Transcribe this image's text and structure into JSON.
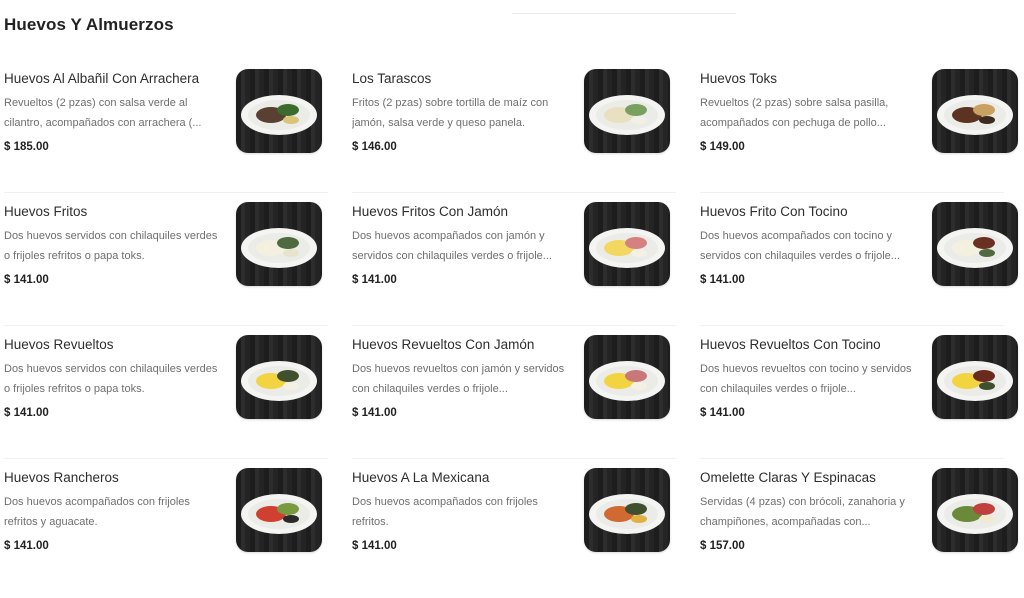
{
  "section": {
    "title": "Huevos Y Almuerzos"
  },
  "items": [
    {
      "name": "Huevos Al Albañil Con Arrachera",
      "desc": "Revueltos (2 pzas) con salsa verde al cilantro, acompañados con arrachera (...",
      "price": "$ 185.00",
      "dish": "eggs-steak-plate-icon"
    },
    {
      "name": "Los Tarascos",
      "desc": "Fritos (2 pzas) sobre tortilla de maíz con jamón, salsa verde y queso panela.",
      "price": "$ 146.00",
      "dish": "tarascos-bowl-icon"
    },
    {
      "name": "Huevos Toks",
      "desc": "Revueltos (2 pzas) sobre salsa pasilla, acompañados con pechuga de pollo...",
      "price": "$ 149.00",
      "dish": "eggs-chicken-plate-icon"
    },
    {
      "name": "Huevos Fritos",
      "desc": "Dos huevos servidos con chilaquiles verdes o frijoles refritos o papa toks.",
      "price": "$ 141.00",
      "dish": "fried-eggs-plate-icon"
    },
    {
      "name": "Huevos Fritos Con Jamón",
      "desc": "Dos huevos acompañados con jamón y servidos con chilaquiles verdes o frijole...",
      "price": "$ 141.00",
      "dish": "fried-eggs-ham-plate-icon"
    },
    {
      "name": "Huevos Frito Con Tocino",
      "desc": "Dos huevos acompañados con tocino y servidos con chilaquiles verdes o frijole...",
      "price": "$ 141.00",
      "dish": "fried-eggs-bacon-plate-icon"
    },
    {
      "name": "Huevos Revueltos",
      "desc": "Dos huevos servidos con chilaquiles verdes o frijoles refritos o papa toks.",
      "price": "$ 141.00",
      "dish": "scrambled-eggs-plate-icon"
    },
    {
      "name": "Huevos Revueltos Con Jamón",
      "desc": "Dos huevos revueltos con jamón y servidos con chilaquiles verdes o frijole...",
      "price": "$ 141.00",
      "dish": "scrambled-eggs-ham-plate-icon"
    },
    {
      "name": "Huevos Revueltos Con Tocino",
      "desc": "Dos huevos revueltos con tocino y servidos con chilaquiles verdes o frijole...",
      "price": "$ 141.00",
      "dish": "scrambled-eggs-bacon-plate-icon"
    },
    {
      "name": "Huevos Rancheros",
      "desc": "Dos huevos acompañados con frijoles refritos y aguacate.",
      "price": "$ 141.00",
      "dish": "rancheros-plate-icon"
    },
    {
      "name": "Huevos A La Mexicana",
      "desc": "Dos huevos acompañados con frijoles refritos.",
      "price": "$ 141.00",
      "dish": "mexicana-eggs-plate-icon"
    },
    {
      "name": "Omelette Claras Y Espinacas",
      "desc": "Servidas (4 pzas) con brócoli, zanahoria y champiñones, acompañadas con...",
      "price": "$ 157.00",
      "dish": "omelette-plate-icon"
    }
  ],
  "colors": {
    "accent": "#222222",
    "muted": "#6f6f6f",
    "thumb_bg": "#1f1f1f"
  }
}
